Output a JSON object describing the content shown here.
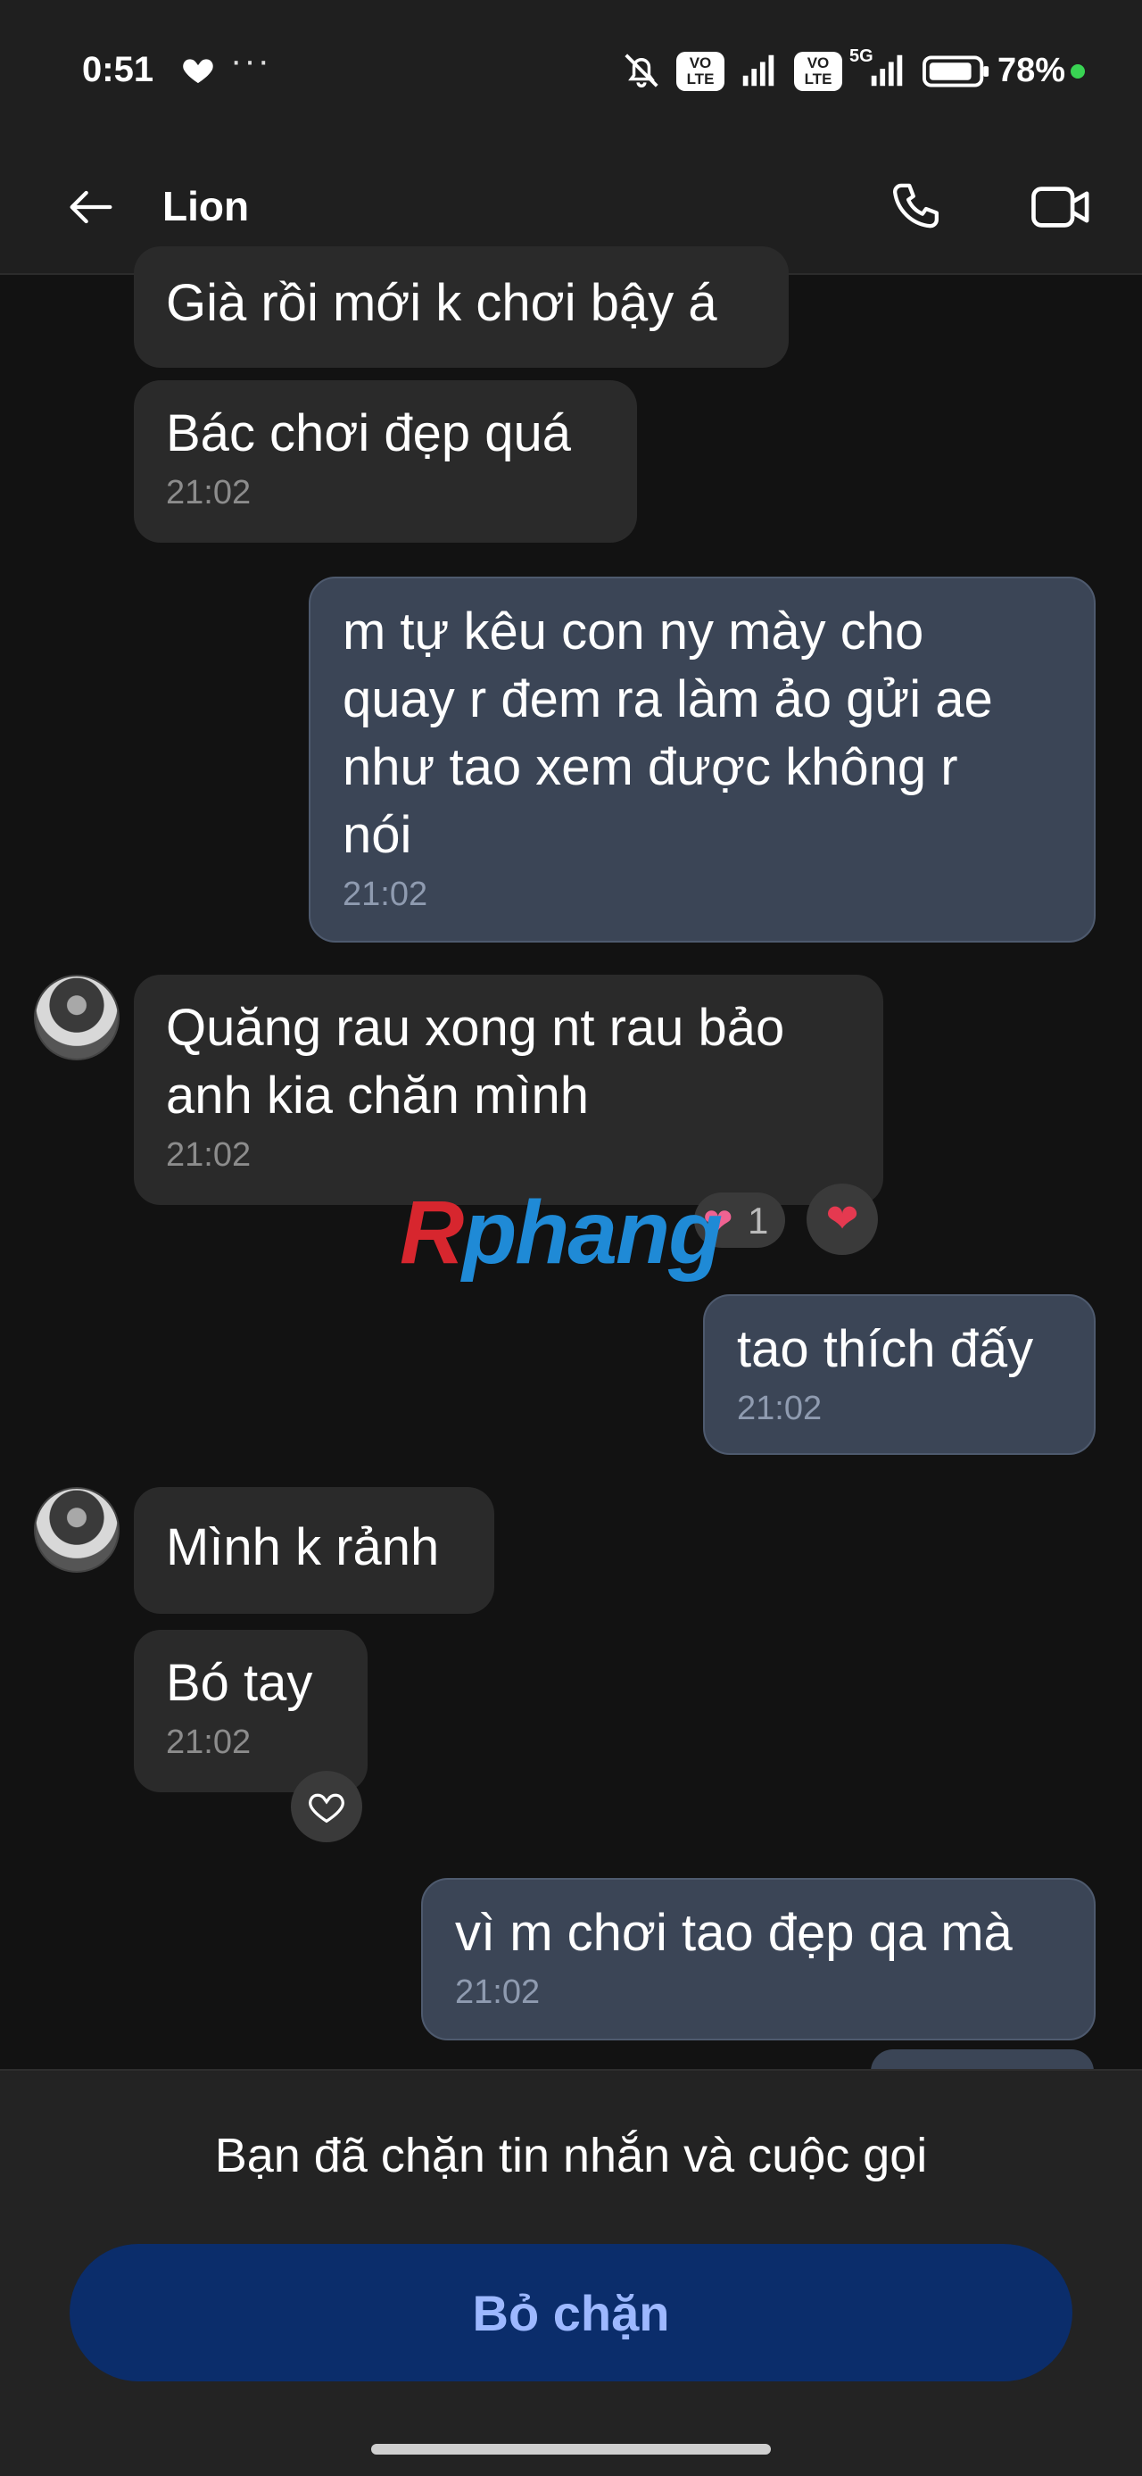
{
  "status_bar": {
    "time": "0:51",
    "dots": "···",
    "volte1": "VO LTE",
    "volte2": "VO LTE",
    "network": "5G",
    "battery": "78%"
  },
  "header": {
    "contact_name": "Lion"
  },
  "messages": [
    {
      "id": "m1",
      "direction": "in",
      "text": "Già rồi mới k chơi bậy á",
      "time": ""
    },
    {
      "id": "m2",
      "direction": "in",
      "text": "Bác chơi đẹp quá",
      "time": "21:02"
    },
    {
      "id": "m3",
      "direction": "out",
      "text": "m tự kêu con ny mày cho\nquay r đem ra làm ảo gửi ae\nnhư tao xem được không r\nnói",
      "time": "21:02"
    },
    {
      "id": "m4",
      "direction": "in",
      "text": "Quăng rau xong nt rau bảo\nanh kia chăn mình",
      "time": "21:02",
      "reaction_count": "1"
    },
    {
      "id": "m5",
      "direction": "out",
      "text": "tao thích đấy",
      "time": "21:02"
    },
    {
      "id": "m6",
      "direction": "in",
      "text": "Mình k rảnh",
      "time": ""
    },
    {
      "id": "m7",
      "direction": "in",
      "text": "Bó tay",
      "time": "21:02"
    },
    {
      "id": "m8",
      "direction": "out",
      "text": "vì m chơi tao đẹp qa mà",
      "time": "21:02"
    }
  ],
  "watermark": {
    "first": "R",
    "rest": "phang"
  },
  "footer": {
    "blocked_text": "Bạn đã chặn tin nhắn và cuộc gọi",
    "unblock_label": "Bỏ chặn"
  },
  "colors": {
    "incoming_bubble": "#2a2a2a",
    "outgoing_bubble": "#3b4556",
    "unblock_button": "#0b2d6b",
    "unblock_text": "#9db8ff"
  }
}
